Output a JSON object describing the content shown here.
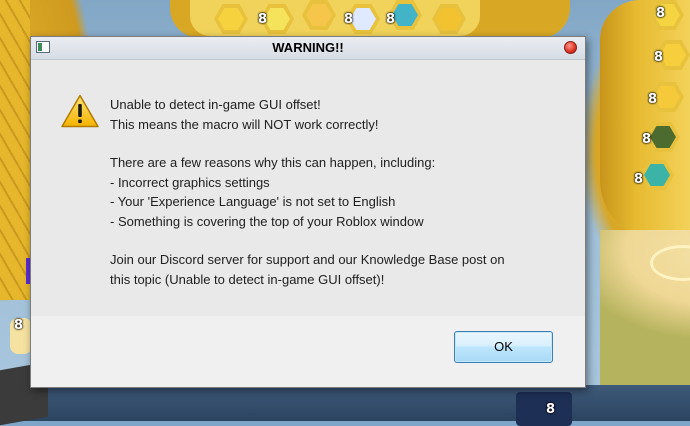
{
  "window": {
    "title": "WARNING!!",
    "app_icon": "window-app-icon",
    "close_icon": "close-icon"
  },
  "dialog": {
    "icon": "warning-icon",
    "heading_lines": [
      "Unable to detect in-game GUI offset!",
      "This means the macro will NOT work correctly!"
    ],
    "reasons_intro": "There are a few reasons why this can happen, including:",
    "reasons": [
      "- Incorrect graphics settings",
      "- Your 'Experience Language' is not set to English",
      "- Something is covering the top of your Roblox window"
    ],
    "support_lines": [
      "Join our Discord server for support and our Knowledge Base post on",
      "this topic (Unable to detect in-game GUI offset)!"
    ]
  },
  "buttons": {
    "ok_label": "OK"
  },
  "background": {
    "hive_cell_labels": [
      "8",
      "8",
      "8",
      "8",
      "8",
      "8",
      "8",
      "8",
      "8",
      "8",
      "8",
      "8"
    ],
    "colors": {
      "hive_gold": "#e8c23c",
      "sky_blue": "#9fc0d8"
    }
  }
}
